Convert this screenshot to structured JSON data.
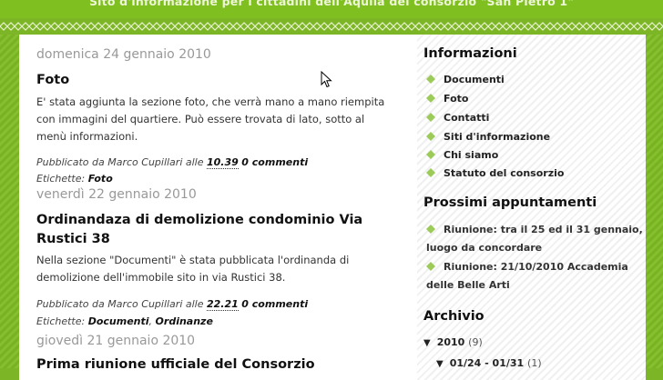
{
  "header": {
    "tagline": "Sito d'informazione per i cittadini dell'Aquila del consorzio \"San Pietro 1\""
  },
  "posts": [
    {
      "date": "domenica 24 gennaio 2010",
      "title": "Foto",
      "body": "E' stata aggiunta la sezione foto, che verrà mano a mano riempita con immagini del quartiere. Può essere trovata di lato, sotto al menù informazioni.",
      "published_prefix": "Pubblicato da Marco Cupillari alle",
      "time": "10.39",
      "comments": "0 commenti",
      "labels_prefix": "Etichette:",
      "labels": [
        "Foto"
      ]
    },
    {
      "date": "venerdì 22 gennaio 2010",
      "title": "Ordinandaza di demolizione condominio Via Rustici 38",
      "body": "Nella sezione \"Documenti\" è stata pubblicata l'ordinanda di demolizione dell'immobile sito in via Rustici 38.",
      "published_prefix": "Pubblicato da Marco Cupillari alle",
      "time": "22.21",
      "comments": "0 commenti",
      "labels_prefix": "Etichette:",
      "labels": [
        "Documenti",
        "Ordinanze"
      ]
    },
    {
      "date": "giovedì 21 gennaio 2010",
      "title": "Prima riunione ufficiale del Consorzio"
    }
  ],
  "sidebar": {
    "info_title": "Informazioni",
    "info_items": [
      "Documenti",
      "Foto",
      "Contatti",
      "Siti d'informazione",
      "Chi siamo",
      "Statuto del consorzio"
    ],
    "appointments_title": "Prossimi appuntamenti",
    "appointments": [
      "Riunione: tra il 25 ed il 31 gennaio, luogo da concordare",
      "Riunione: 21/10/2010 Accademia delle Belle Arti"
    ],
    "archive_title": "Archivio",
    "archive_year": "2010",
    "archive_year_count": "(9)",
    "archive_week": "01/24 - 01/31",
    "archive_week_count": "(1)"
  },
  "colors": {
    "background_green": "#7cb526",
    "bullet_green": "#9ccb5a",
    "date_gray": "#999999"
  }
}
